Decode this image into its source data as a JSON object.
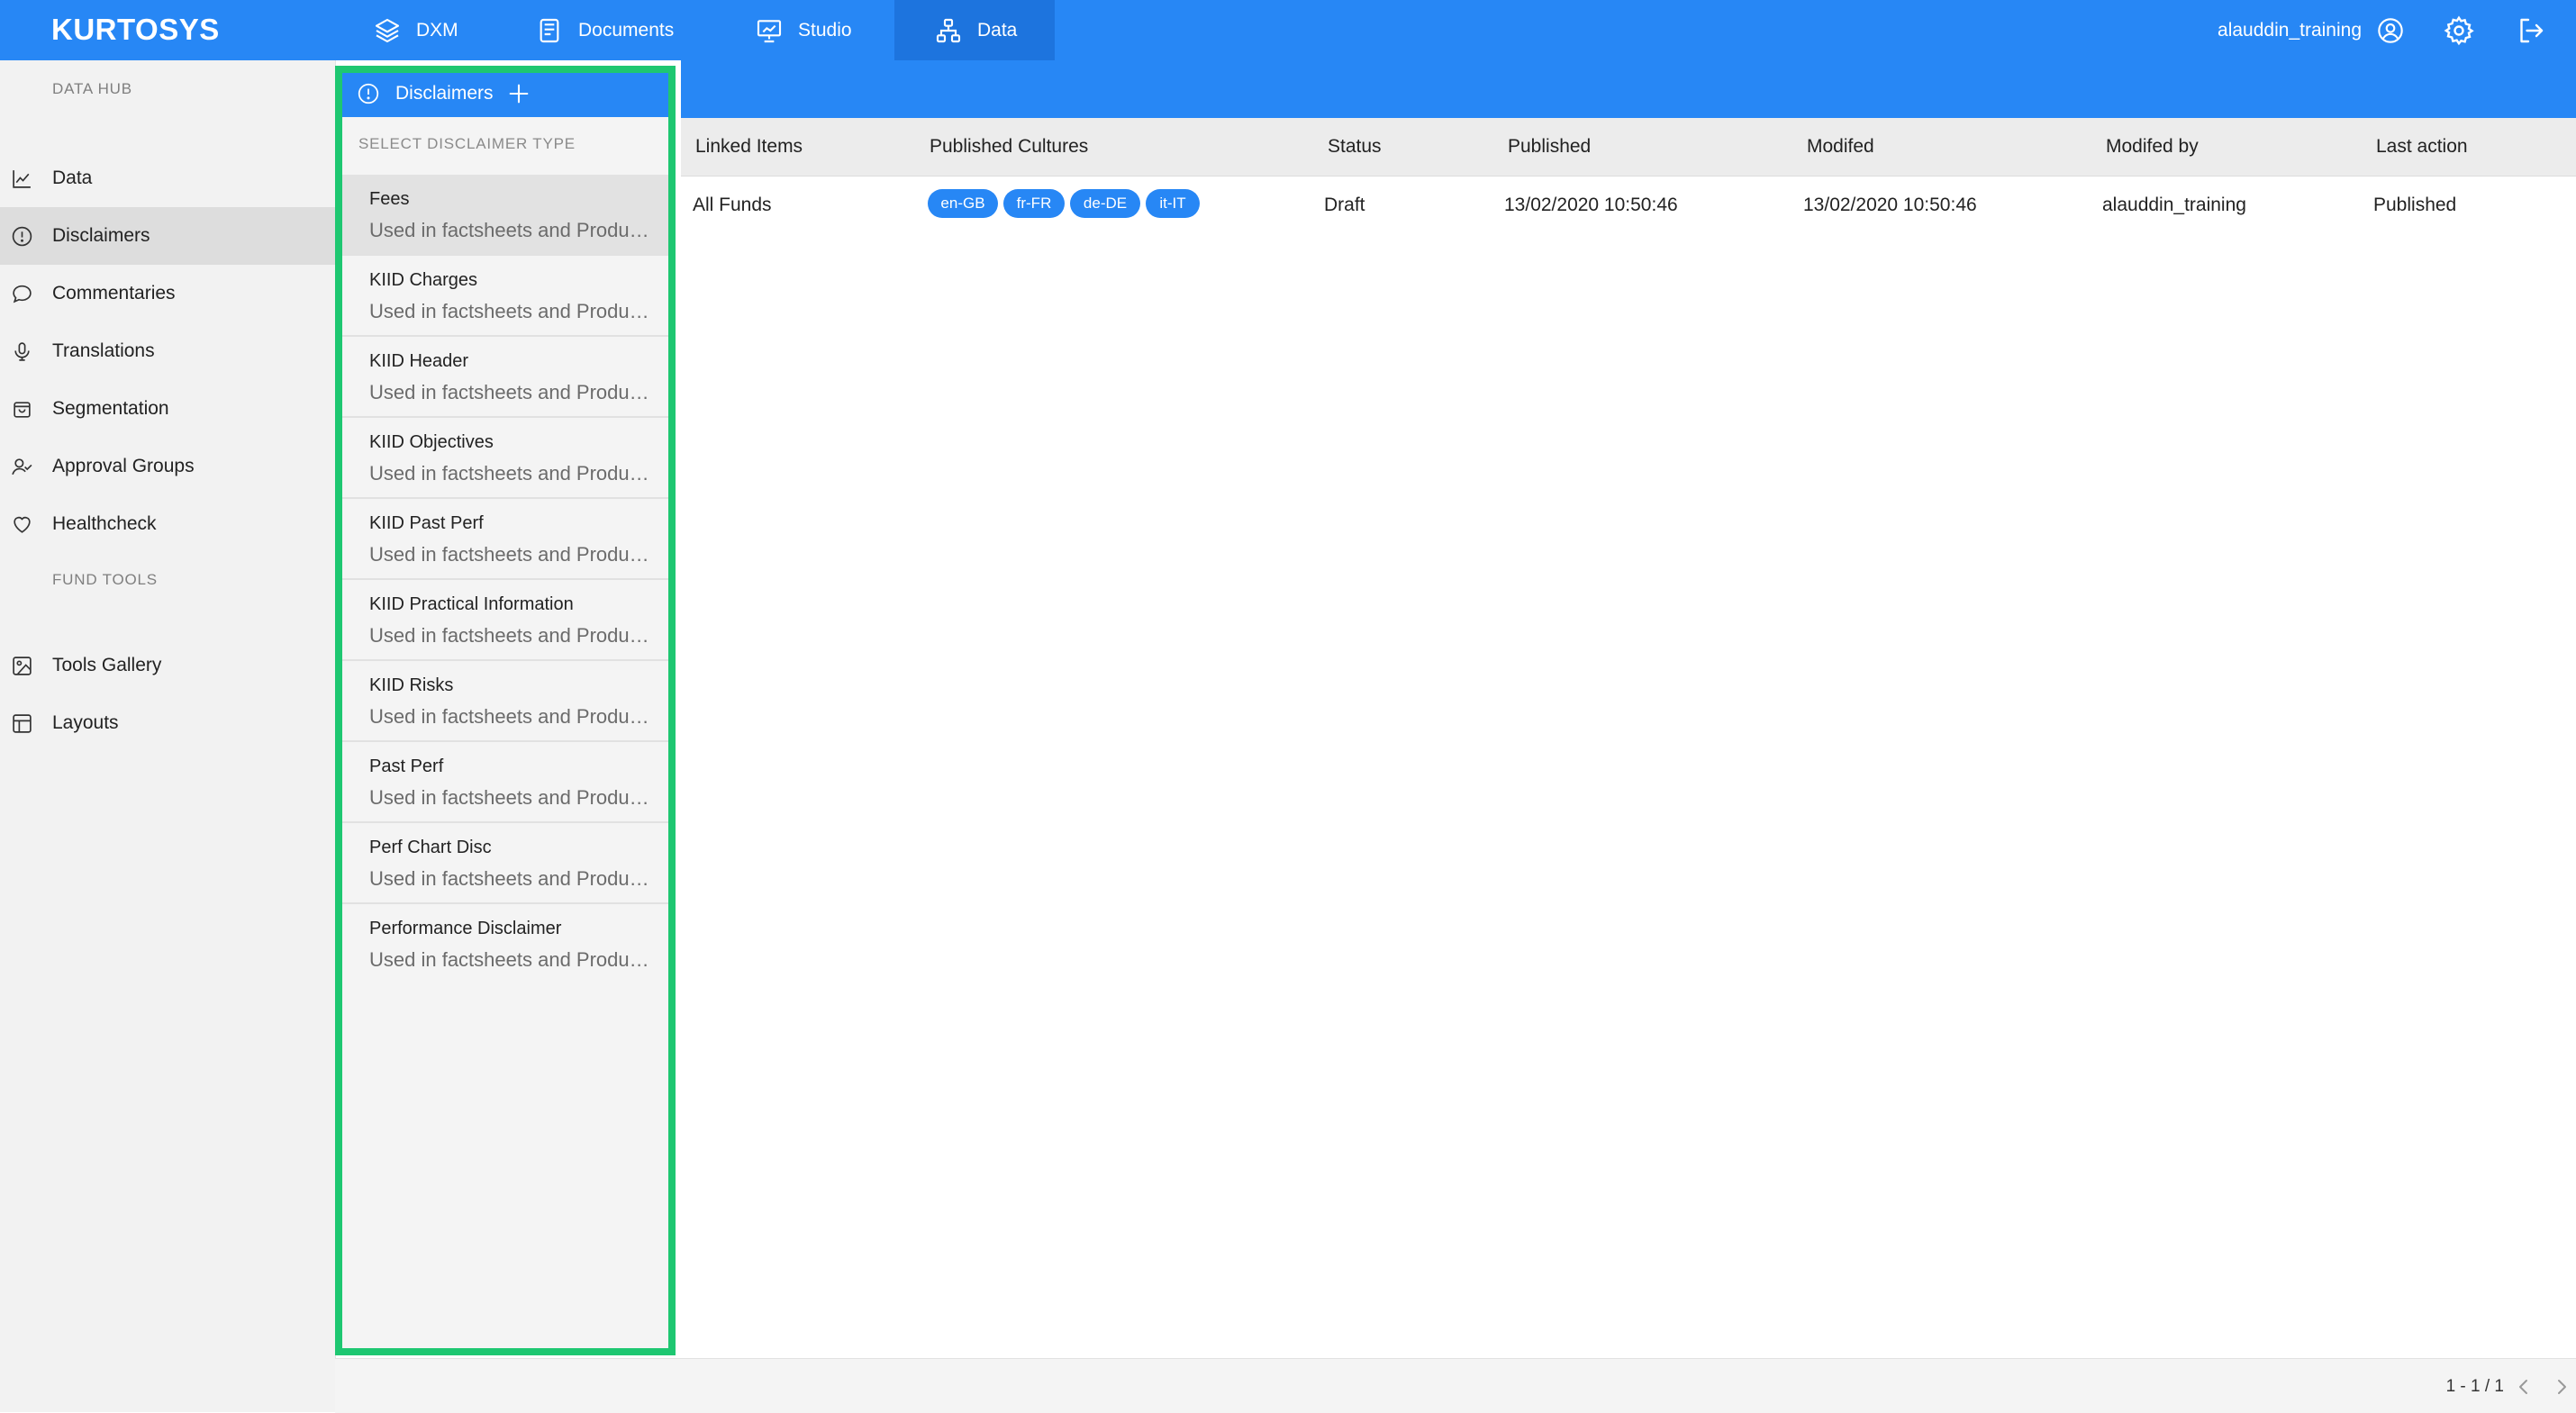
{
  "app": {
    "logo": "KURTOSYS",
    "accent_color": "#2787f5",
    "highlight_color": "#1ec771"
  },
  "topnav": {
    "tabs": [
      {
        "label": "DXM",
        "icon": "layers-icon"
      },
      {
        "label": "Documents",
        "icon": "document-icon"
      },
      {
        "label": "Studio",
        "icon": "presentation-icon"
      },
      {
        "label": "Data",
        "icon": "hierarchy-icon",
        "active": true
      }
    ],
    "username": "alauddin_training"
  },
  "sidebar": {
    "section1": "DATA HUB",
    "items": [
      {
        "label": "Data",
        "icon": "chart-icon"
      },
      {
        "label": "Disclaimers",
        "icon": "alert-circle-icon",
        "active": true
      },
      {
        "label": "Commentaries",
        "icon": "comment-icon"
      },
      {
        "label": "Translations",
        "icon": "microphone-icon"
      },
      {
        "label": "Segmentation",
        "icon": "bag-icon"
      },
      {
        "label": "Approval Groups",
        "icon": "user-check-icon"
      },
      {
        "label": "Healthcheck",
        "icon": "heart-icon"
      }
    ],
    "section2": "FUND TOOLS",
    "tools": [
      {
        "label": "Tools Gallery",
        "icon": "image-icon"
      },
      {
        "label": "Layouts",
        "icon": "layout-icon"
      }
    ]
  },
  "disclaimers_panel": {
    "title": "Disclaimers",
    "add_label": "+",
    "caption": "SELECT DISCLAIMER TYPE",
    "types": [
      {
        "name": "Fees",
        "desc": "Used in factsheets and Product pages",
        "active": true
      },
      {
        "name": "KIID Charges",
        "desc": "Used in factsheets and Product pages"
      },
      {
        "name": "KIID Header",
        "desc": "Used in factsheets and Product pages"
      },
      {
        "name": "KIID Objectives",
        "desc": "Used in factsheets and Product pages"
      },
      {
        "name": "KIID Past Perf",
        "desc": "Used in factsheets and Product pages"
      },
      {
        "name": "KIID Practical Information",
        "desc": "Used in factsheets and Product pages"
      },
      {
        "name": "KIID Risks",
        "desc": "Used in factsheets and Product pages"
      },
      {
        "name": "Past Perf",
        "desc": "Used in factsheets and Product pages"
      },
      {
        "name": "Perf Chart Disc",
        "desc": "Used in factsheets and Product pages"
      },
      {
        "name": "Performance Disclaimer",
        "desc": "Used in factsheets and Product pages"
      }
    ]
  },
  "table": {
    "columns": [
      "Linked Items",
      "Published Cultures",
      "Status",
      "Published",
      "Modifed",
      "Modifed by",
      "Last action"
    ],
    "rows": [
      {
        "linked": "All Funds",
        "cultures": [
          "en-GB",
          "fr-FR",
          "de-DE",
          "it-IT"
        ],
        "status": "Draft",
        "published": "13/02/2020 10:50:46",
        "modified": "13/02/2020 10:50:46",
        "modified_by": "alauddin_training",
        "last_action": "Published"
      }
    ]
  },
  "pagination": {
    "text": "1 - 1 / 1"
  }
}
